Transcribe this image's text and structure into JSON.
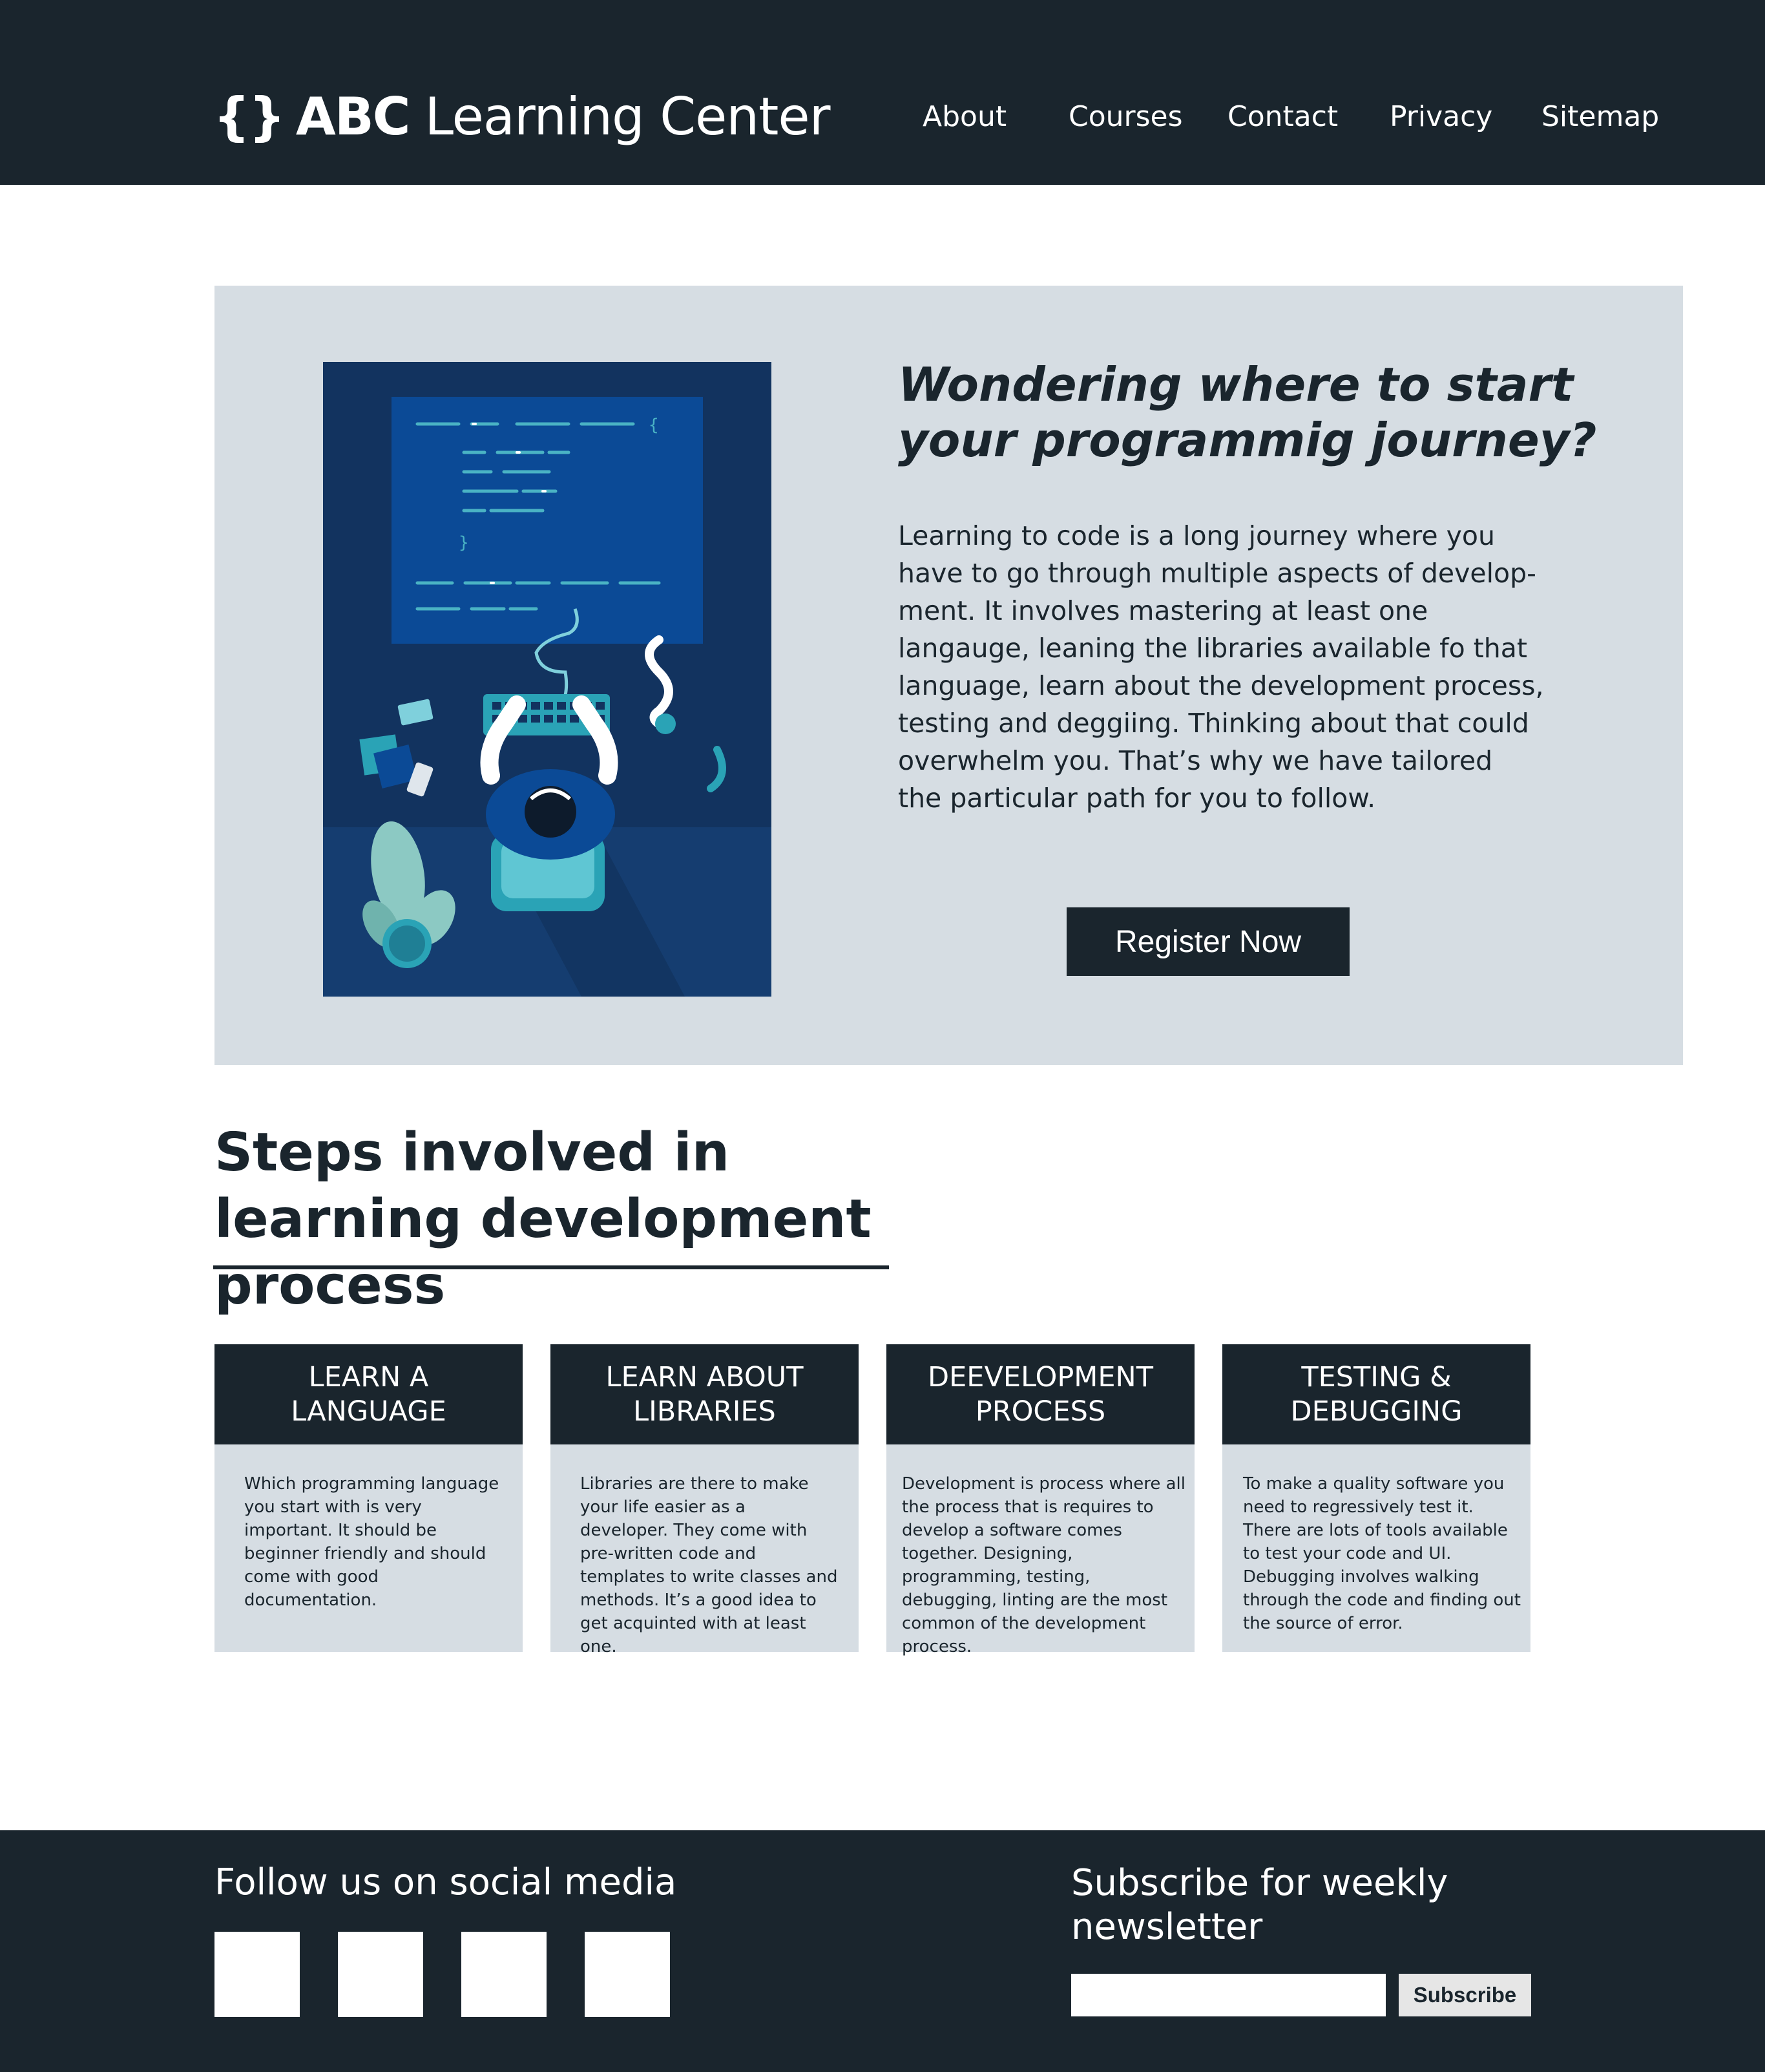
{
  "header": {
    "logo_braces": "{}",
    "logo_abc": "ABC",
    "logo_name": "Learning Center",
    "nav": [
      "About",
      "Courses",
      "Contact",
      "Privacy",
      "Sitemap"
    ]
  },
  "hero": {
    "title": "Wondering where to start your programmig journey?",
    "body": "Learning to code is a long journey where you have to go through multiple aspects of develop-ment. It involves mastering at least one langauge, leaning the libraries available fo that language, learn about the development process, testing and deggiing. Thinking about that could overwhelm you. That’s why we have tailored the particular path for you to follow.",
    "register_label": "Register Now"
  },
  "steps": {
    "title": "Steps involved in learning development process",
    "cards": [
      {
        "heading": "LEARN A LANGUAGE",
        "body": "Which programming language you start with is very important. It should be beginner friendly and should come with good documentation."
      },
      {
        "heading": "LEARN ABOUT LIBRARIES",
        "body": "Libraries are there to make your life easier as a developer. They come with pre-written code and templates to write classes and methods. It’s a good idea to get acquinted with at least one."
      },
      {
        "heading": "DEEVELOPMENT PROCESS",
        "body": "Development is process where all the process that is requires to develop a software comes together. Designing, programming, testing, debugging, linting are the most common of the development process."
      },
      {
        "heading": "TESTING & DEBUGGING",
        "body": "To make a quality software you need to regressively test it. There are lots of tools available to test your code and UI. Debugging involves walking through the code and finding out the source of error."
      }
    ]
  },
  "footer": {
    "follow_title": "Follow us on social media",
    "subscribe_title": "Subscribe for weekly newsletter",
    "subscribe_input_value": "",
    "subscribe_label": "Subscribe"
  },
  "colors": {
    "dark": "#1a252d",
    "panel": "#d6dde3",
    "illustration_bg": "#12335f",
    "white": "#ffffff"
  }
}
